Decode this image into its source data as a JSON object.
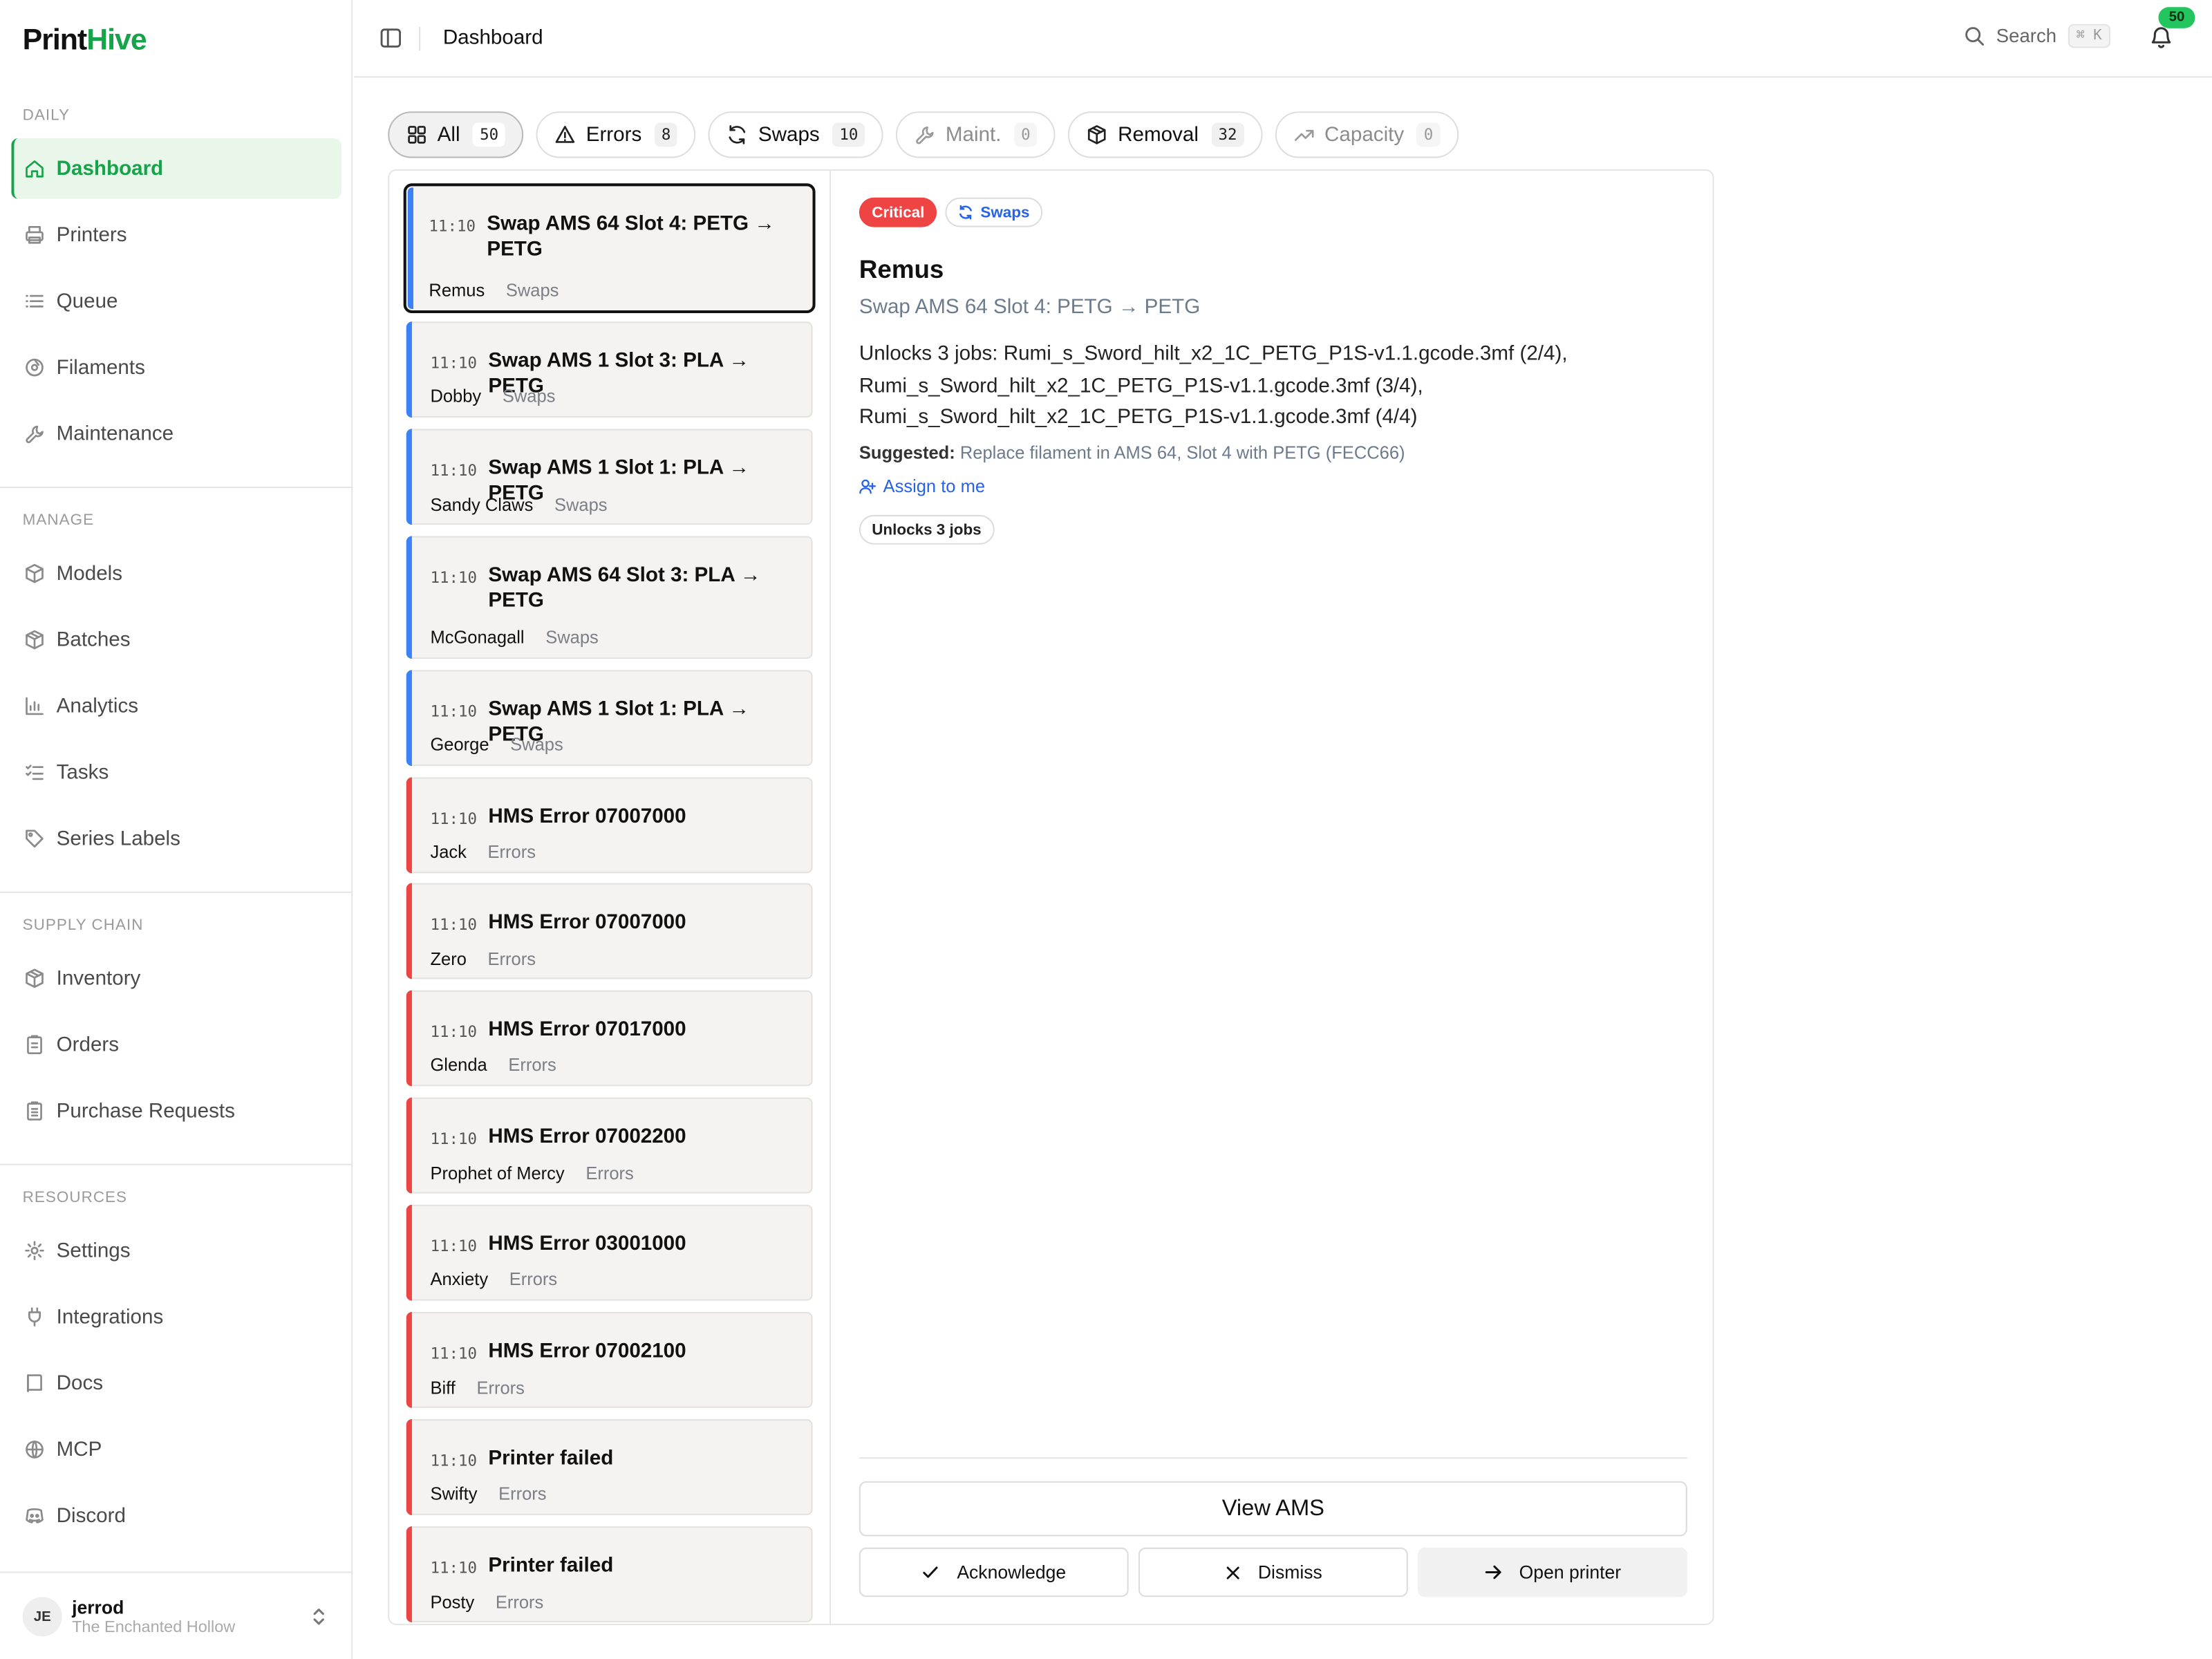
{
  "app": {
    "logo_part1": "Print",
    "logo_part2": "Hive",
    "brand_color": "#16a34a"
  },
  "sidebar": {
    "sections": [
      {
        "label": "DAILY",
        "items": [
          {
            "label": "Dashboard",
            "icon": "home-icon",
            "active": true
          },
          {
            "label": "Printers",
            "icon": "printer-icon"
          },
          {
            "label": "Queue",
            "icon": "list-icon"
          },
          {
            "label": "Filaments",
            "icon": "spool-icon"
          },
          {
            "label": "Maintenance",
            "icon": "wrench-icon"
          }
        ]
      },
      {
        "label": "MANAGE",
        "items": [
          {
            "label": "Models",
            "icon": "box-icon"
          },
          {
            "label": "Batches",
            "icon": "boxes-icon"
          },
          {
            "label": "Analytics",
            "icon": "bar-chart-icon"
          },
          {
            "label": "Tasks",
            "icon": "checklist-icon"
          },
          {
            "label": "Series Labels",
            "icon": "tag-icon"
          }
        ]
      },
      {
        "label": "SUPPLY CHAIN",
        "items": [
          {
            "label": "Inventory",
            "icon": "package-icon"
          },
          {
            "label": "Orders",
            "icon": "clipboard-icon"
          },
          {
            "label": "Purchase Requests",
            "icon": "clipboard-list-icon"
          }
        ]
      },
      {
        "label": "RESOURCES",
        "items": [
          {
            "label": "Settings",
            "icon": "gear-icon"
          },
          {
            "label": "Integrations",
            "icon": "plug-icon"
          },
          {
            "label": "Docs",
            "icon": "book-icon"
          },
          {
            "label": "MCP",
            "icon": "network-icon"
          },
          {
            "label": "Discord",
            "icon": "discord-icon"
          }
        ]
      }
    ],
    "user": {
      "initials": "JE",
      "name": "jerrod",
      "org": "The Enchanted Hollow"
    }
  },
  "topbar": {
    "title": "Dashboard",
    "search_label": "Search",
    "search_shortcut": "⌘ K",
    "notification_count": "50"
  },
  "filters": [
    {
      "label": "All",
      "count": "50",
      "icon": "grid-icon",
      "selected": true
    },
    {
      "label": "Errors",
      "count": "8",
      "icon": "warning-icon"
    },
    {
      "label": "Swaps",
      "count": "10",
      "icon": "refresh-icon"
    },
    {
      "label": "Maint.",
      "count": "0",
      "icon": "wrench-icon",
      "dim": true
    },
    {
      "label": "Removal",
      "count": "32",
      "icon": "package-icon"
    },
    {
      "label": "Capacity",
      "count": "0",
      "icon": "trend-up-icon",
      "dim": true
    }
  ],
  "alerts": [
    {
      "time": "11:10",
      "title": "Swap AMS 64 Slot 4: PETG → PETG",
      "printer": "Remus",
      "category": "Swaps",
      "color": "blue",
      "selected": true
    },
    {
      "time": "11:10",
      "title": "Swap AMS 1 Slot 3: PLA → PETG",
      "printer": "Dobby",
      "category": "Swaps",
      "color": "blue"
    },
    {
      "time": "11:10",
      "title": "Swap AMS 1 Slot 1: PLA → PETG",
      "printer": "Sandy Claws",
      "category": "Swaps",
      "color": "blue"
    },
    {
      "time": "11:10",
      "title": "Swap AMS 64 Slot 3: PLA → PETG",
      "printer": "McGonagall",
      "category": "Swaps",
      "color": "blue"
    },
    {
      "time": "11:10",
      "title": "Swap AMS 1 Slot 1: PLA → PETG",
      "printer": "George",
      "category": "Swaps",
      "color": "blue"
    },
    {
      "time": "11:10",
      "title": "HMS Error 07007000",
      "printer": "Jack",
      "category": "Errors",
      "color": "red"
    },
    {
      "time": "11:10",
      "title": "HMS Error 07007000",
      "printer": "Zero",
      "category": "Errors",
      "color": "red"
    },
    {
      "time": "11:10",
      "title": "HMS Error 07017000",
      "printer": "Glenda",
      "category": "Errors",
      "color": "red"
    },
    {
      "time": "11:10",
      "title": "HMS Error 07002200",
      "printer": "Prophet of Mercy",
      "category": "Errors",
      "color": "red"
    },
    {
      "time": "11:10",
      "title": "HMS Error 03001000",
      "printer": "Anxiety",
      "category": "Errors",
      "color": "red"
    },
    {
      "time": "11:10",
      "title": "HMS Error 07002100",
      "printer": "Biff",
      "category": "Errors",
      "color": "red"
    },
    {
      "time": "11:10",
      "title": "Printer failed",
      "printer": "Swifty",
      "category": "Errors",
      "color": "red"
    },
    {
      "time": "11:10",
      "title": "Printer failed",
      "printer": "Posty",
      "category": "Errors",
      "color": "red"
    }
  ],
  "detail": {
    "severity": "Critical",
    "category": "Swaps",
    "printer": "Remus",
    "subtitle": "Swap AMS 64 Slot 4: PETG → PETG",
    "description_lines": [
      "Unlocks 3 jobs: Rumi_s_Sword_hilt_x2_1C_PETG_P1S-v1.1.gcode.3mf (2/4),",
      "Rumi_s_Sword_hilt_x2_1C_PETG_P1S-v1.1.gcode.3mf (3/4),",
      "Rumi_s_Sword_hilt_x2_1C_PETG_P1S-v1.1.gcode.3mf (4/4)"
    ],
    "suggested_label": "Suggested:",
    "suggested_text": "Replace filament in AMS 64, Slot 4 with PETG (FECC66)",
    "assign_label": "Assign to me",
    "chip_label": "Unlocks 3 jobs",
    "view_button": "View AMS",
    "acknowledge_button": "Acknowledge",
    "dismiss_button": "Dismiss",
    "open_button": "Open printer",
    "severity_color": "#ef4444"
  }
}
